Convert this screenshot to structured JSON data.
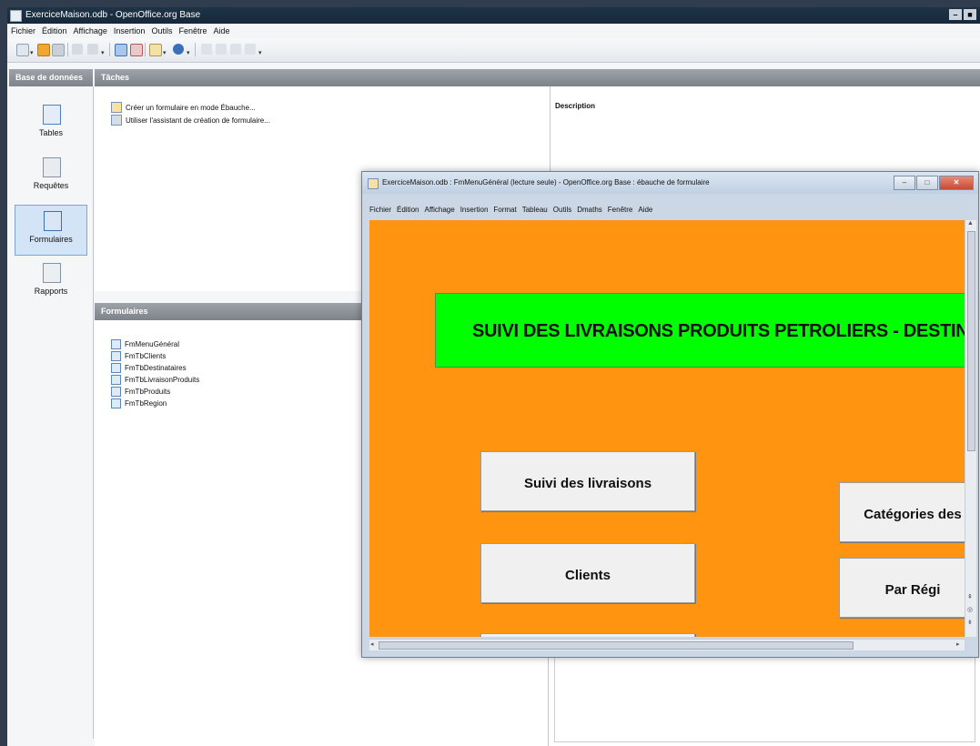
{
  "main_window": {
    "title": "ExerciceMaison.odb - OpenOffice.org Base",
    "controls": [
      "–",
      "■"
    ]
  },
  "menubar": [
    "Fichier",
    "Édition",
    "Affichage",
    "Insertion",
    "Outils",
    "Fenêtre",
    "Aide"
  ],
  "database_pane": {
    "header": "Base de données",
    "items": [
      {
        "label": "Tables",
        "icon": "tables-icon",
        "selected": false
      },
      {
        "label": "Requêtes",
        "icon": "queries-icon",
        "selected": false
      },
      {
        "label": "Formulaires",
        "icon": "forms-icon",
        "selected": true
      },
      {
        "label": "Rapports",
        "icon": "reports-icon",
        "selected": false
      }
    ]
  },
  "tasks": {
    "header": "Tâches",
    "items": [
      "Créer un formulaire en mode Ébauche...",
      "Utiliser l'assistant de création de formulaire..."
    ],
    "description_label": "Description"
  },
  "forms": {
    "header": "Formulaires",
    "items": [
      "FmMenuGénéral",
      "FmTbClients",
      "FmTbDestinataires",
      "FmTbLivraisonProduits",
      "FmTbProduits",
      "FmTbRegion"
    ]
  },
  "form_window": {
    "title": "ExerciceMaison.odb : FmMenuGénéral (lecture seule) - OpenOffice.org Base : ébauche de formulaire",
    "menubar": [
      "Fichier",
      "Édition",
      "Affichage",
      "Insertion",
      "Format",
      "Tableau",
      "Outils",
      "Dmaths",
      "Fenêtre",
      "Aide"
    ],
    "canvas_color": "#ff9411",
    "banner": {
      "text": "SUIVI DES LIVRAISONS PRODUITS PETROLIERS - DESTINATAI",
      "color": "#00ff00"
    },
    "buttons": [
      "Suivi des livraisons",
      "Clients",
      "Catégories des",
      "Par Régi"
    ]
  }
}
